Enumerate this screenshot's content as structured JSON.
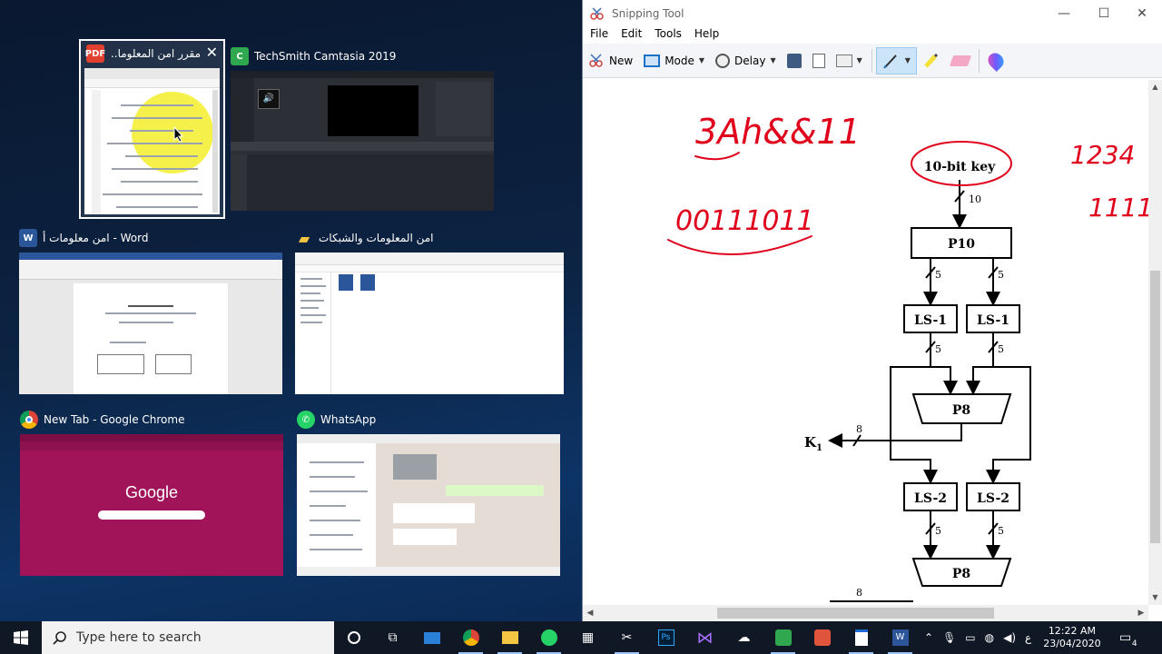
{
  "taskview": {
    "windows": [
      {
        "title": "مقرر امن المعلوما...",
        "app": "pdf-reader"
      },
      {
        "title": "TechSmith Camtasia 2019",
        "app": "camtasia"
      },
      {
        "title": "امن معلومات أ - Word",
        "app": "word"
      },
      {
        "title": "امن المعلومات والشبكات",
        "app": "file-explorer"
      },
      {
        "title": "New Tab - Google Chrome",
        "app": "chrome"
      },
      {
        "title": "WhatsApp",
        "app": "whatsapp"
      }
    ],
    "chrome_thumb": {
      "logo": "Google"
    }
  },
  "snipping_tool": {
    "title": "Snipping Tool",
    "menu": [
      "File",
      "Edit",
      "Tools",
      "Help"
    ],
    "toolbar": {
      "new": "New",
      "mode": "Mode",
      "delay": "Delay"
    },
    "diagram": {
      "input": "10-bit key",
      "p10": "P10",
      "ls1_left": "LS-1",
      "ls1_right": "LS-1",
      "p8_top": "P8",
      "ls2_left": "LS-2",
      "ls2_right": "LS-2",
      "p8_bottom": "P8",
      "k1": "K",
      "k1_sub": "1",
      "w10": "10",
      "w5": "5",
      "w8": "8",
      "annot_key": "3Ah&&11",
      "annot_bits": "00111011",
      "annot_right_top": "1234",
      "annot_right_bottom": "1111"
    }
  },
  "taskbar": {
    "search_placeholder": "Type here to search",
    "time": "12:22 AM",
    "date": "23/04/2020",
    "lang": "ع",
    "notifications": "4"
  },
  "colors": {
    "accent": "#0078d7",
    "chrome_thumb_bg": "#a1145a",
    "annot_red": "#e0001b"
  }
}
